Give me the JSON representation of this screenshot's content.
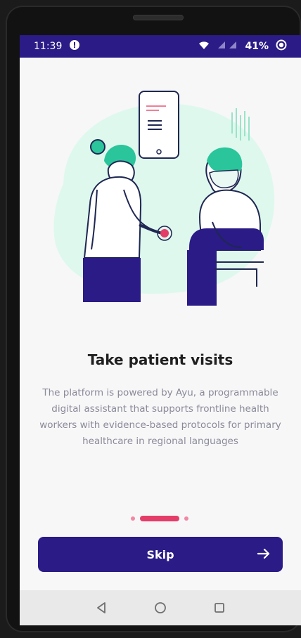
{
  "statusbar": {
    "time": "11:39",
    "battery_percent": "41%",
    "icons": [
      "notification-icon",
      "wifi-icon",
      "signal-icon",
      "battery-icon"
    ]
  },
  "content": {
    "title": "Take patient visits",
    "description": "The platform is powered by Ayu, a programmable digital assistant that supports frontline health workers with evidence-based protocols for primary healthcare in regional languages"
  },
  "pager": {
    "active_index": 1,
    "page_count": 3
  },
  "actions": {
    "skip_label": "Skip"
  },
  "colors": {
    "primary": "#2a1b86",
    "accent": "#e43d69",
    "illustration_teal": "#2ac59b",
    "illustration_bg": "#dff8ee"
  },
  "navigation": {
    "icons": [
      "back-icon",
      "home-icon",
      "recents-icon"
    ]
  }
}
